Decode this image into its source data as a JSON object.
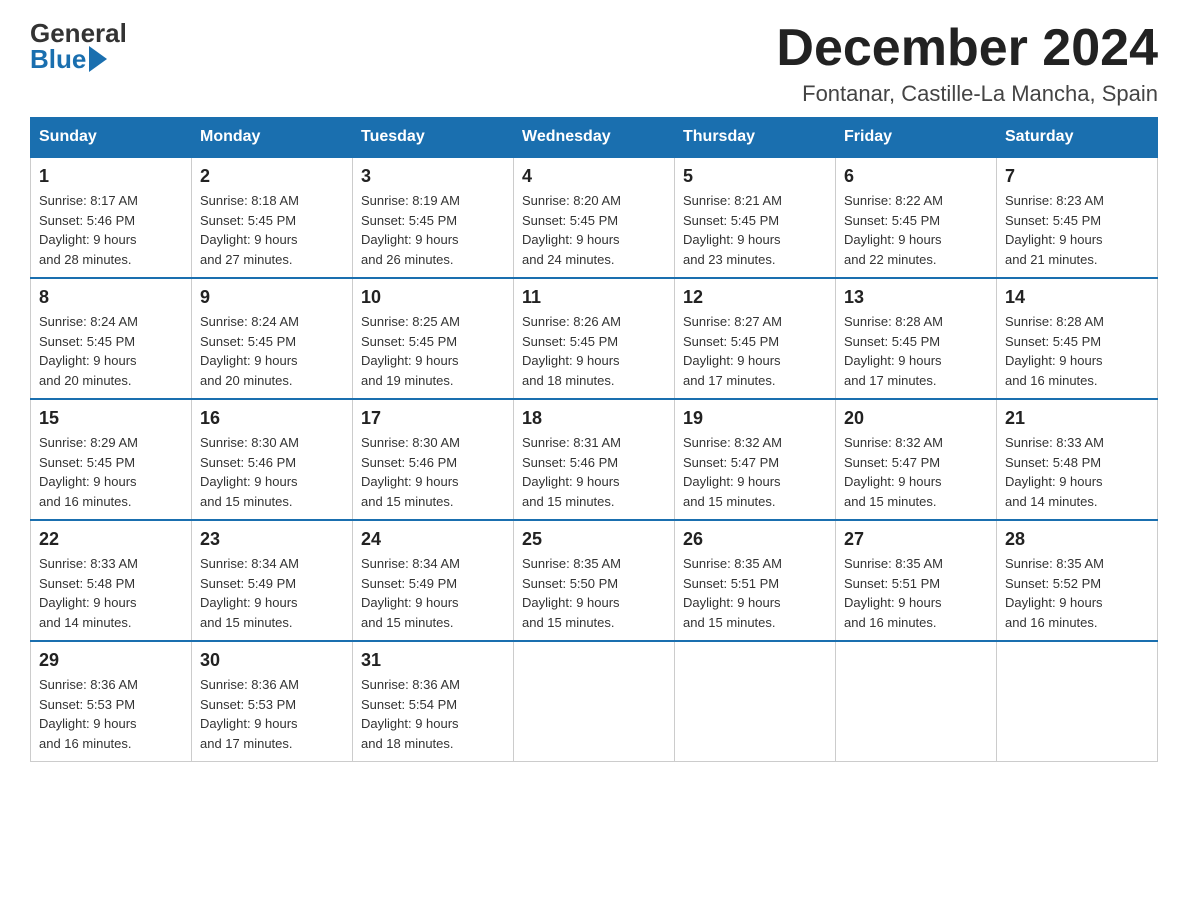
{
  "logo": {
    "general": "General",
    "blue": "Blue",
    "icon_label": "general-blue-logo"
  },
  "title": "December 2024",
  "subtitle": "Fontanar, Castille-La Mancha, Spain",
  "days_of_week": [
    "Sunday",
    "Monday",
    "Tuesday",
    "Wednesday",
    "Thursday",
    "Friday",
    "Saturday"
  ],
  "weeks": [
    [
      {
        "day": "1",
        "sunrise": "8:17 AM",
        "sunset": "5:46 PM",
        "daylight": "9 hours and 28 minutes."
      },
      {
        "day": "2",
        "sunrise": "8:18 AM",
        "sunset": "5:45 PM",
        "daylight": "9 hours and 27 minutes."
      },
      {
        "day": "3",
        "sunrise": "8:19 AM",
        "sunset": "5:45 PM",
        "daylight": "9 hours and 26 minutes."
      },
      {
        "day": "4",
        "sunrise": "8:20 AM",
        "sunset": "5:45 PM",
        "daylight": "9 hours and 24 minutes."
      },
      {
        "day": "5",
        "sunrise": "8:21 AM",
        "sunset": "5:45 PM",
        "daylight": "9 hours and 23 minutes."
      },
      {
        "day": "6",
        "sunrise": "8:22 AM",
        "sunset": "5:45 PM",
        "daylight": "9 hours and 22 minutes."
      },
      {
        "day": "7",
        "sunrise": "8:23 AM",
        "sunset": "5:45 PM",
        "daylight": "9 hours and 21 minutes."
      }
    ],
    [
      {
        "day": "8",
        "sunrise": "8:24 AM",
        "sunset": "5:45 PM",
        "daylight": "9 hours and 20 minutes."
      },
      {
        "day": "9",
        "sunrise": "8:24 AM",
        "sunset": "5:45 PM",
        "daylight": "9 hours and 20 minutes."
      },
      {
        "day": "10",
        "sunrise": "8:25 AM",
        "sunset": "5:45 PM",
        "daylight": "9 hours and 19 minutes."
      },
      {
        "day": "11",
        "sunrise": "8:26 AM",
        "sunset": "5:45 PM",
        "daylight": "9 hours and 18 minutes."
      },
      {
        "day": "12",
        "sunrise": "8:27 AM",
        "sunset": "5:45 PM",
        "daylight": "9 hours and 17 minutes."
      },
      {
        "day": "13",
        "sunrise": "8:28 AM",
        "sunset": "5:45 PM",
        "daylight": "9 hours and 17 minutes."
      },
      {
        "day": "14",
        "sunrise": "8:28 AM",
        "sunset": "5:45 PM",
        "daylight": "9 hours and 16 minutes."
      }
    ],
    [
      {
        "day": "15",
        "sunrise": "8:29 AM",
        "sunset": "5:45 PM",
        "daylight": "9 hours and 16 minutes."
      },
      {
        "day": "16",
        "sunrise": "8:30 AM",
        "sunset": "5:46 PM",
        "daylight": "9 hours and 15 minutes."
      },
      {
        "day": "17",
        "sunrise": "8:30 AM",
        "sunset": "5:46 PM",
        "daylight": "9 hours and 15 minutes."
      },
      {
        "day": "18",
        "sunrise": "8:31 AM",
        "sunset": "5:46 PM",
        "daylight": "9 hours and 15 minutes."
      },
      {
        "day": "19",
        "sunrise": "8:32 AM",
        "sunset": "5:47 PM",
        "daylight": "9 hours and 15 minutes."
      },
      {
        "day": "20",
        "sunrise": "8:32 AM",
        "sunset": "5:47 PM",
        "daylight": "9 hours and 15 minutes."
      },
      {
        "day": "21",
        "sunrise": "8:33 AM",
        "sunset": "5:48 PM",
        "daylight": "9 hours and 14 minutes."
      }
    ],
    [
      {
        "day": "22",
        "sunrise": "8:33 AM",
        "sunset": "5:48 PM",
        "daylight": "9 hours and 14 minutes."
      },
      {
        "day": "23",
        "sunrise": "8:34 AM",
        "sunset": "5:49 PM",
        "daylight": "9 hours and 15 minutes."
      },
      {
        "day": "24",
        "sunrise": "8:34 AM",
        "sunset": "5:49 PM",
        "daylight": "9 hours and 15 minutes."
      },
      {
        "day": "25",
        "sunrise": "8:35 AM",
        "sunset": "5:50 PM",
        "daylight": "9 hours and 15 minutes."
      },
      {
        "day": "26",
        "sunrise": "8:35 AM",
        "sunset": "5:51 PM",
        "daylight": "9 hours and 15 minutes."
      },
      {
        "day": "27",
        "sunrise": "8:35 AM",
        "sunset": "5:51 PM",
        "daylight": "9 hours and 16 minutes."
      },
      {
        "day": "28",
        "sunrise": "8:35 AM",
        "sunset": "5:52 PM",
        "daylight": "9 hours and 16 minutes."
      }
    ],
    [
      {
        "day": "29",
        "sunrise": "8:36 AM",
        "sunset": "5:53 PM",
        "daylight": "9 hours and 16 minutes."
      },
      {
        "day": "30",
        "sunrise": "8:36 AM",
        "sunset": "5:53 PM",
        "daylight": "9 hours and 17 minutes."
      },
      {
        "day": "31",
        "sunrise": "8:36 AM",
        "sunset": "5:54 PM",
        "daylight": "9 hours and 18 minutes."
      },
      null,
      null,
      null,
      null
    ]
  ],
  "labels": {
    "sunrise": "Sunrise:",
    "sunset": "Sunset:",
    "daylight": "Daylight:"
  }
}
